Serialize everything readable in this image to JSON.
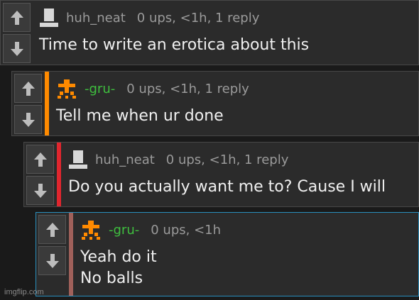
{
  "comments": [
    {
      "username": "huh_neat",
      "meta": "0 ups, <1h, 1 reply",
      "text": "Time to write an erotica about this",
      "avatar": "top-hat-avatar",
      "username_color": "#9a9a9a",
      "stripe_color": ""
    },
    {
      "username": "-gru-",
      "meta": "0 ups, <1h, 1 reply",
      "text": "Tell me when ur done",
      "avatar": "pixel-figure-avatar",
      "username_color": "#3fbf3f",
      "stripe_color": "#ff8a00"
    },
    {
      "username": "huh_neat",
      "meta": "0 ups, <1h, 1 reply",
      "text": "Do you actually want me to? Cause I will",
      "avatar": "top-hat-avatar",
      "username_color": "#9a9a9a",
      "stripe_color": "#e0262e"
    },
    {
      "username": "-gru-",
      "meta": "0 ups, <1h",
      "text": "Yeah do it\nNo balls",
      "avatar": "pixel-figure-avatar",
      "username_color": "#3fbf3f",
      "stripe_color": "#a0605a"
    }
  ],
  "icons": {
    "upvote": "up-arrow-icon",
    "downvote": "down-arrow-icon"
  },
  "watermark": "imgflip.com"
}
